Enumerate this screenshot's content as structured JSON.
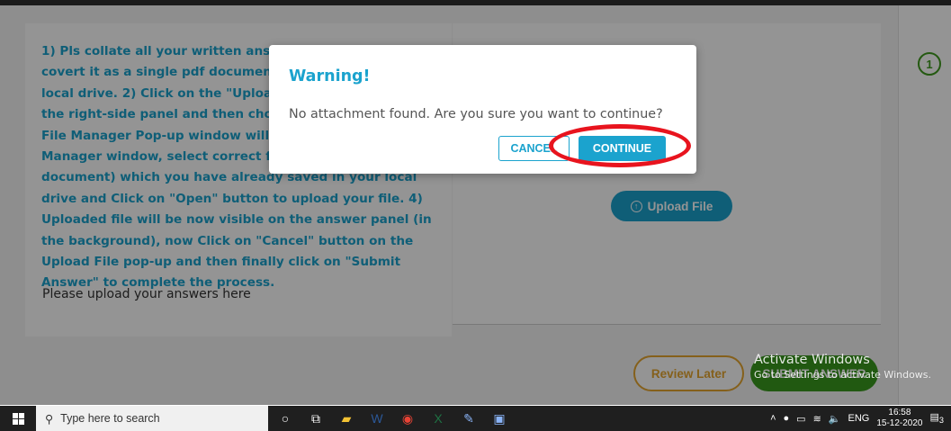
{
  "page": {
    "instructions": "1) Pls collate all your written answers in a proper order, covert it as a single pdf document and save it in your PC local drive. 2) Click on the \"Upload File\" button given on the right-side panel and then choose the upload option. File Manager Pop-up window will open. 3) In File Manager window, select correct file (Answer script PDF document) which you have already saved in your local drive and Click on \"Open\" button to upload your file. 4) Uploaded file will be now visible on the answer panel (in the background), now Click on \"Cancel\" button on the Upload File pop-up and then finally click on \"Submit Answer\" to complete the process.",
    "upload_prompt": "Please upload your answers here",
    "upload_button": "Upload File",
    "upload_icon": "upload-circle-icon",
    "review_later": "Review Later",
    "submit_answer": "SUBMIT ANSWER",
    "question_number": "1",
    "accent_color": "#1ba3ce",
    "success_color": "#3a9a1e",
    "warning_color": "#e5a630"
  },
  "modal": {
    "title": "Warning!",
    "message": "No attachment found. Are you sure you want to continue?",
    "cancel": "CANCEL",
    "continue": "CONTINUE"
  },
  "watermark": {
    "title": "Activate Windows",
    "subtitle": "Go to Settings to activate Windows."
  },
  "taskbar": {
    "search_placeholder": "Type here to search",
    "language": "ENG",
    "time": "16:58",
    "date": "15-12-2020",
    "notification_count": "3",
    "pinned_icons": [
      "cortana-icon",
      "task-view-icon",
      "file-explorer-icon",
      "word-icon",
      "chrome-icon",
      "excel-icon",
      "paint-icon",
      "app-icon"
    ]
  }
}
